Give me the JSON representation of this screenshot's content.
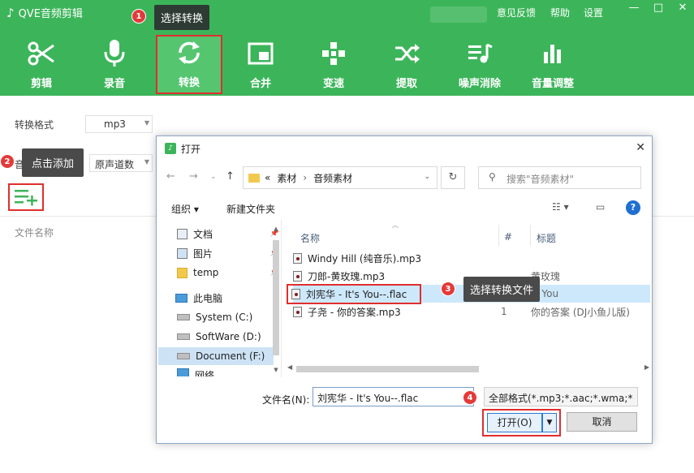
{
  "app": {
    "title": "QVE音频剪辑",
    "menu": {
      "feedback": "意见反馈",
      "help": "帮助",
      "settings": "设置"
    },
    "window_controls": {
      "minimize": "—",
      "maximize": "□",
      "close": "✕"
    },
    "brand_color": "#3cb55a"
  },
  "toolbar": [
    {
      "label": "剪辑",
      "icon": "scissors-icon"
    },
    {
      "label": "录音",
      "icon": "microphone-icon"
    },
    {
      "label": "转换",
      "icon": "convert-icon"
    },
    {
      "label": "合并",
      "icon": "merge-icon"
    },
    {
      "label": "变速",
      "icon": "speed-icon"
    },
    {
      "label": "提取",
      "icon": "extract-icon"
    },
    {
      "label": "噪声消除",
      "icon": "noise-remove-icon"
    },
    {
      "label": "音量调整",
      "icon": "volume-bars-icon"
    }
  ],
  "left_panel": {
    "format_label": "转换格式",
    "format_value": "mp3",
    "channel_label": "音",
    "channel_value": "原声道数",
    "file_name_header": "文件名称"
  },
  "callouts": [
    {
      "num": "1",
      "text": "选择转换"
    },
    {
      "num": "2",
      "text": "点击添加"
    },
    {
      "num": "3",
      "text": "选择转换文件"
    },
    {
      "num": "4",
      "text": ""
    }
  ],
  "dialog": {
    "title": "打开",
    "close": "✕",
    "breadcrumb": {
      "prefix": "«",
      "parts": [
        "素材",
        "音频素材"
      ],
      "sep": "›"
    },
    "search_placeholder": "搜索\"音频素材\"",
    "organize": "组织 ▾",
    "new_folder": "新建文件夹",
    "help": "?",
    "tree": [
      {
        "label": "文档",
        "icon": "document-icon",
        "pinned": true
      },
      {
        "label": "图片",
        "icon": "picture-icon",
        "pinned": true
      },
      {
        "label": "temp",
        "icon": "folder-icon",
        "pinned": true
      },
      {
        "label": "此电脑",
        "icon": "computer-icon",
        "pinned": false
      },
      {
        "label": "System (C:)",
        "icon": "drive-icon",
        "pinned": false
      },
      {
        "label": "SoftWare (D:)",
        "icon": "drive-icon",
        "pinned": false
      },
      {
        "label": "Document (F:)",
        "icon": "drive-icon",
        "pinned": false,
        "selected": true
      },
      {
        "label": "网络",
        "icon": "network-icon",
        "pinned": false
      }
    ],
    "columns": {
      "name": "名称",
      "num": "#",
      "title": "标题"
    },
    "files": [
      {
        "name": "Windy Hill (纯音乐).mp3",
        "num": "",
        "title": ""
      },
      {
        "name": "刀郎-黄玫瑰.mp3",
        "num": "",
        "title": "黄玫瑰"
      },
      {
        "name": "刘宪华 - It's You--.flac",
        "num": "",
        "title": "'s You",
        "selected": true
      },
      {
        "name": "子尧 - 你的答案.mp3",
        "num": "1",
        "title": "你的答案 (DJ小鱼儿版)"
      }
    ],
    "filename_label": "文件名(N):",
    "filename_value": "刘宪华 - It's You--.flac",
    "filetype_value": "全部格式(*.mp3;*.aac;*.wma;*",
    "open_button": "打开(O)",
    "cancel_button": "取消"
  }
}
